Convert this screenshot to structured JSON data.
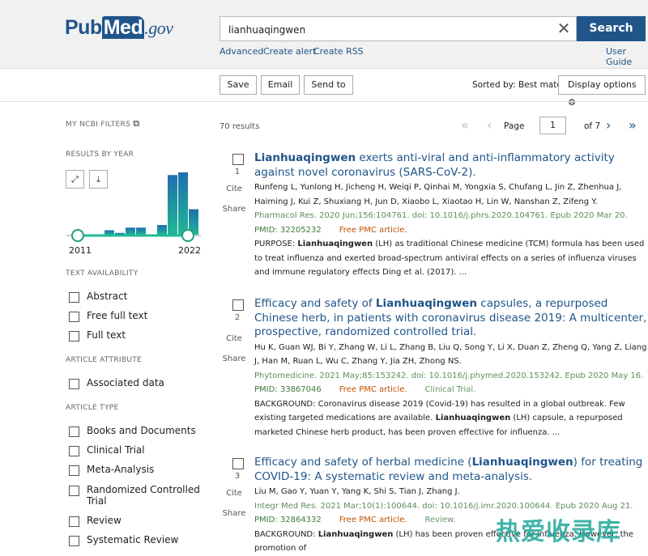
{
  "header": {
    "logo": "PubMed.gov",
    "logo_pub": "Pub",
    "logo_med": "Med",
    "logo_gov": ".gov",
    "search_value": "lianhuaqingwen",
    "search_button": "Search",
    "links": [
      "Advanced",
      "Create alert",
      "Create RSS"
    ],
    "user_guide": "User Guide"
  },
  "toolbar": {
    "save": "Save",
    "email": "Email",
    "send_to": "Send to",
    "sorted_by": "Sorted by: Best match",
    "display_options": "Display options"
  },
  "results_count": "70 results",
  "pager": {
    "page_label": "Page",
    "page_value": "1",
    "of": "of 7"
  },
  "sidebar": {
    "my_ncbi_filters": "MY NCBI FILTERS",
    "results_by_year": "RESULTS BY YEAR",
    "year_start": "2011",
    "year_end": "2022",
    "text_availability": "TEXT AVAILABILITY",
    "text_options": [
      "Abstract",
      "Free full text",
      "Full text"
    ],
    "article_attribute": "ARTICLE ATTRIBUTE",
    "attribute_options": [
      "Associated data"
    ],
    "article_type": "ARTICLE TYPE",
    "type_options": [
      "Books and Documents",
      "Clinical Trial",
      "Meta-Analysis",
      "Randomized Controlled Trial",
      "Review",
      "Systematic Review"
    ]
  },
  "chart_data": {
    "type": "bar",
    "categories": [
      "2011",
      "2012",
      "2013",
      "2014",
      "2015",
      "2016",
      "2017",
      "2018",
      "2019",
      "2020",
      "2021",
      "2022"
    ],
    "values": [
      0,
      0,
      0,
      2,
      1,
      3,
      3,
      0,
      4,
      23,
      24,
      10
    ],
    "colors": {
      "top": "#1f6fb0",
      "bottom": "#20b994"
    }
  },
  "results": [
    {
      "num": "1",
      "title": [
        {
          "t": "Lianhuaqingwen",
          "b": true
        },
        {
          "t": " exerts anti-viral and anti-inflammatory activity against novel coronavirus (SARS-CoV-2).",
          "b": false
        }
      ],
      "authors": "Runfeng L, Yunlong H, Jicheng H, Weiqi P, Qinhai M, Yongxia S, Chufang L, Jin Z, Zhenhua J, Haiming J, Kui Z, Shuxiang H, Jun D, Xiaobo L, Xiaotao H, Lin W, Nanshan Z, Zifeng Y.",
      "journal": "Pharmacol Res. 2020 Jun;156:104761. doi: 10.1016/j.phrs.2020.104761. Epub 2020 Mar 20.",
      "pmid": "PMID: 32205232",
      "free": "Free PMC article.",
      "type": "",
      "abstract": [
        {
          "t": "PURPOSE: ",
          "b": false
        },
        {
          "t": "Lianhuaqingwen",
          "b": true
        },
        {
          "t": " (LH) as traditional Chinese medicine (TCM) formula has been used to treat influenza and exerted broad-spectrum antiviral effects on a series of influenza viruses and immune regulatory effects Ding et al. (2017). ...",
          "b": false
        }
      ]
    },
    {
      "num": "2",
      "title": [
        {
          "t": "Efficacy and safety of ",
          "b": false
        },
        {
          "t": "Lianhuaqingwen",
          "b": true
        },
        {
          "t": " capsules, a repurposed Chinese herb, in patients with coronavirus disease 2019: A multicenter, prospective, randomized controlled trial.",
          "b": false
        }
      ],
      "authors": "Hu K, Guan WJ, Bi Y, Zhang W, Li L, Zhang B, Liu Q, Song Y, Li X, Duan Z, Zheng Q, Yang Z, Liang J, Han M, Ruan L, Wu C, Zhang Y, Jia ZH, Zhong NS.",
      "journal": "Phytomedicine. 2021 May;85:153242. doi: 10.1016/j.phymed.2020.153242. Epub 2020 May 16.",
      "pmid": "PMID: 33867046",
      "free": "Free PMC article.",
      "type": "Clinical Trial.",
      "abstract": [
        {
          "t": "BACKGROUND: Coronavirus disease 2019 (Covid-19) has resulted in a global outbreak. Few existing targeted medications are available. ",
          "b": false
        },
        {
          "t": "Lianhuaqingwen",
          "b": true
        },
        {
          "t": " (LH) capsule, a repurposed marketed Chinese herb product, has been proven effective for influenza. ...",
          "b": false
        }
      ]
    },
    {
      "num": "3",
      "title": [
        {
          "t": "Efficacy and safety of herbal medicine (",
          "b": false
        },
        {
          "t": "Lianhuaqingwen",
          "b": true
        },
        {
          "t": ") for treating COVID-19: A systematic review and meta-analysis.",
          "b": false
        }
      ],
      "authors": "Liu M, Gao Y, Yuan Y, Yang K, Shi S, Tian J, Zhang J.",
      "journal": "Integr Med Res. 2021 Mar;10(1):100644. doi: 10.1016/j.imr.2020.100644. Epub 2020 Aug 21.",
      "pmid": "PMID: 32864332",
      "free": "Free PMC article.",
      "type": "Review.",
      "abstract": [
        {
          "t": "BACKGROUND: ",
          "b": false
        },
        {
          "t": "Lianhuaqingwen",
          "b": true
        },
        {
          "t": " (LH) has been proven effective for influenza. However, the promotion of",
          "b": false
        }
      ]
    }
  ],
  "result_actions": {
    "cite": "Cite",
    "share": "Share"
  },
  "watermark": "热爱收录库"
}
